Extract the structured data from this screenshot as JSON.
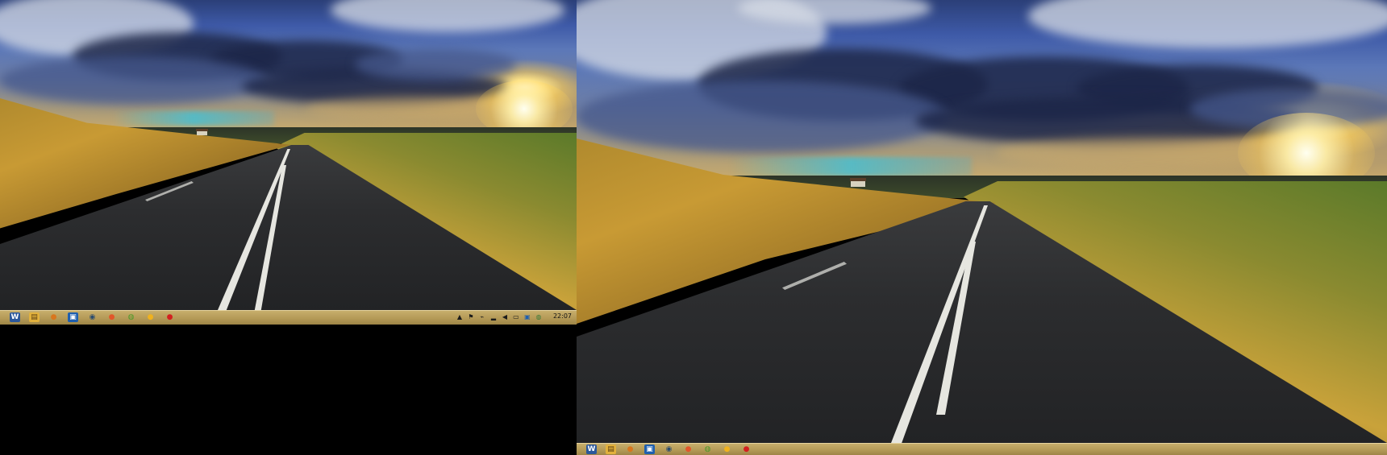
{
  "desktop": {
    "monitors": [
      {
        "id": "left",
        "wallpaper": "road-sunset-landscape",
        "taskbar": {
          "pinned_apps": [
            {
              "name": "word-icon",
              "glyph": "W",
              "color": "#2b579a"
            },
            {
              "name": "file-explorer-icon",
              "glyph": "▤",
              "color": "#e2b13c"
            },
            {
              "name": "media-player-icon",
              "glyph": "●",
              "color": "#d8761e"
            },
            {
              "name": "outlook-icon",
              "glyph": "▣",
              "color": "#1f5fae"
            },
            {
              "name": "steam-icon",
              "glyph": "◉",
              "color": "#2a4b6e"
            },
            {
              "name": "firefox-icon",
              "glyph": "●",
              "color": "#e2562a"
            },
            {
              "name": "chrome-icon",
              "glyph": "◍",
              "color": "#4c9a2a"
            },
            {
              "name": "yellow-app-icon",
              "glyph": "●",
              "color": "#f0b21e"
            },
            {
              "name": "opera-icon",
              "glyph": "●",
              "color": "#d3201f"
            }
          ],
          "tray": [
            {
              "name": "show-hidden-icons-icon",
              "glyph": "▲"
            },
            {
              "name": "flag-icon",
              "glyph": "⚑"
            },
            {
              "name": "usb-icon",
              "glyph": "⌁"
            },
            {
              "name": "network-signal-icon",
              "glyph": "▂"
            },
            {
              "name": "volume-icon",
              "glyph": "◀"
            },
            {
              "name": "monitor-icon",
              "glyph": "▭"
            },
            {
              "name": "settings-tray-icon",
              "glyph": "▣"
            },
            {
              "name": "globe-icon",
              "glyph": "◍"
            }
          ],
          "clock": "22:07"
        }
      },
      {
        "id": "right",
        "wallpaper": "road-sunset-landscape",
        "taskbar": {
          "pinned_apps": [
            {
              "name": "word-icon",
              "glyph": "W",
              "color": "#2b579a"
            },
            {
              "name": "file-explorer-icon",
              "glyph": "▤",
              "color": "#e2b13c"
            },
            {
              "name": "media-player-icon",
              "glyph": "●",
              "color": "#d8761e"
            },
            {
              "name": "outlook-icon",
              "glyph": "▣",
              "color": "#1f5fae"
            },
            {
              "name": "steam-icon",
              "glyph": "◉",
              "color": "#2a4b6e"
            },
            {
              "name": "firefox-icon",
              "glyph": "●",
              "color": "#e2562a"
            },
            {
              "name": "chrome-icon",
              "glyph": "◍",
              "color": "#4c9a2a"
            },
            {
              "name": "yellow-app-icon",
              "glyph": "●",
              "color": "#f0b21e"
            },
            {
              "name": "opera-icon",
              "glyph": "●",
              "color": "#d3201f"
            }
          ]
        }
      }
    ],
    "colors": {
      "taskbar": "#b49a57",
      "background": "#000000"
    }
  }
}
